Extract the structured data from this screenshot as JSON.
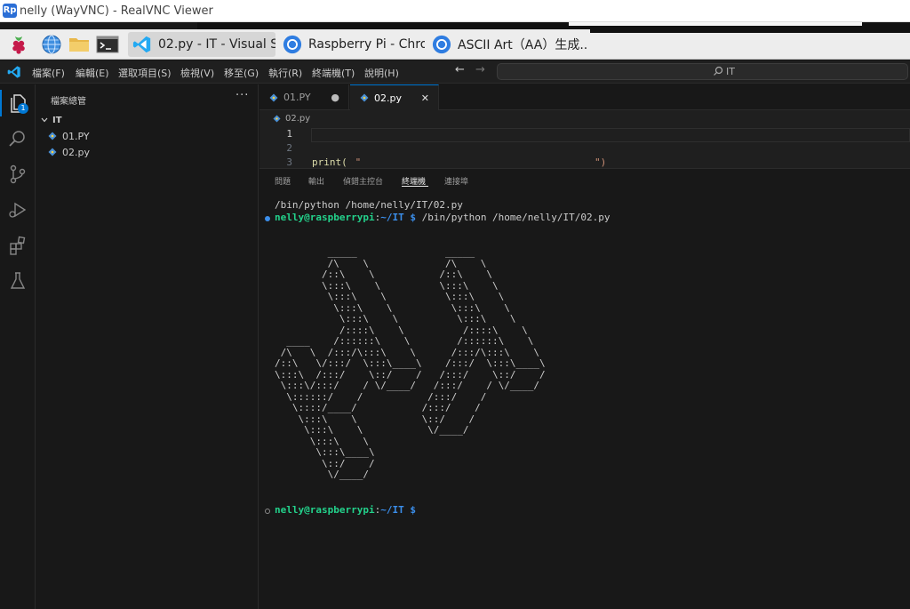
{
  "vnc": {
    "title": "nelly (WayVNC) - RealVNC Viewer",
    "logo_text": "Rp"
  },
  "taskbar": {
    "tasks": [
      {
        "label": "02.py - IT - Visual St..",
        "icon": "vscode-icon"
      },
      {
        "label": "Raspberry Pi - Chro..",
        "icon": "chrome-icon"
      },
      {
        "label": "ASCII Art（AA）生成..",
        "icon": "chrome-icon"
      }
    ],
    "launchers": [
      "raspberry-pi-menu-icon",
      "globe-icon",
      "folder-icon",
      "terminal-icon"
    ]
  },
  "menubar": {
    "items": [
      "檔案(F)",
      "編輯(E)",
      "選取項目(S)",
      "檢視(V)",
      "移至(G)",
      "執行(R)",
      "終端機(T)",
      "說明(H)"
    ],
    "back": "←",
    "forward": "→",
    "search_text": "IT"
  },
  "activity": {
    "badge": "1"
  },
  "sidebar": {
    "title": "檔案總管",
    "more": "···",
    "folder": "IT",
    "files": [
      "01.PY",
      "02.py"
    ]
  },
  "tabs": [
    {
      "label": "01.PY",
      "indicator": "●"
    },
    {
      "label": "02.py",
      "indicator": "✕"
    }
  ],
  "editor": {
    "breadcrumb": "02.py",
    "line_numbers": [
      "1",
      "2",
      "3"
    ],
    "line3_print": "print(",
    "line3_open": " \"",
    "line3_close": "\")"
  },
  "panel": {
    "tabs": [
      "問題",
      "輸出",
      "偵錯主控台",
      "終端機",
      "連接埠"
    ]
  },
  "terminal": {
    "cmd_line": "/bin/python /home/nelly/IT/02.py",
    "user_host": "nelly@raspberrypi",
    "colon": ":",
    "path": "~/IT $",
    "prompt_cmd": " /bin/python /home/nelly/IT/02.py",
    "ascii_art": "         _____               _____\n         /\\    \\             /\\    \\\n        /::\\    \\           /::\\    \\\n        \\:::\\    \\          \\:::\\    \\\n         \\:::\\    \\          \\:::\\    \\\n          \\:::\\    \\          \\:::\\    \\\n           \\:::\\    \\          \\:::\\    \\\n           /::::\\    \\          /::::\\    \\\n  ____    /::::::\\    \\        /::::::\\    \\\n /\\   \\  /:::/\\:::\\    \\      /:::/\\:::\\    \\\n/::\\   \\/:::/  \\:::\\____\\    /:::/  \\:::\\____\\\n\\:::\\  /:::/    \\::/    /   /:::/    \\::/    /\n \\:::\\/:::/    / \\/____/   /:::/    / \\/____/\n  \\::::::/    /           /:::/    /\n   \\::::/____/           /:::/    /\n    \\:::\\    \\           \\::/    /\n     \\:::\\    \\           \\/____/\n      \\:::\\    \\\n       \\:::\\____\\\n        \\::/    /\n         \\/____/"
  },
  "colors": {
    "accent": "#0078d4",
    "terminal_user": "#23d18b",
    "terminal_path": "#3b8eea",
    "python_blue": "#4a90d6",
    "string_orange": "#ce9178",
    "function_yellow": "#dcdcaa"
  }
}
